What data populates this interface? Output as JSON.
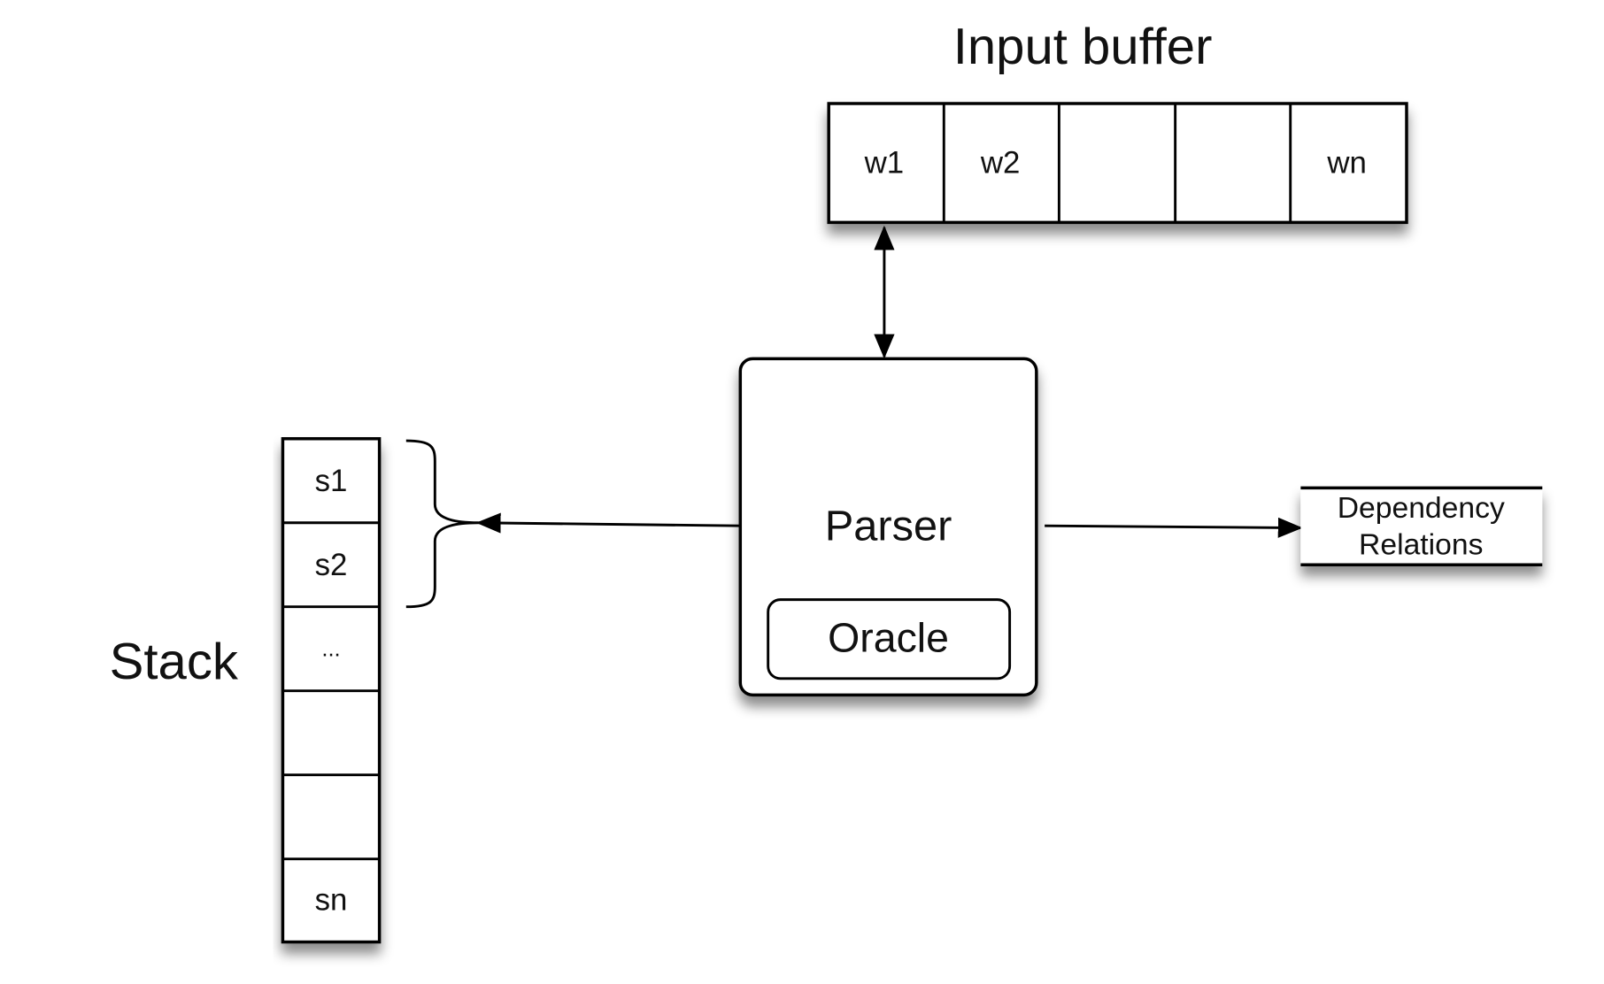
{
  "input_buffer": {
    "title": "Input buffer",
    "cells": [
      "w1",
      "w2",
      "",
      "",
      "wn"
    ]
  },
  "parser": {
    "label": "Parser",
    "oracle_label": "Oracle"
  },
  "stack": {
    "title": "Stack",
    "cells": [
      "s1",
      "s2",
      "...",
      "",
      "",
      "sn"
    ]
  },
  "output": {
    "line1": "Dependency",
    "line2": "Relations"
  }
}
